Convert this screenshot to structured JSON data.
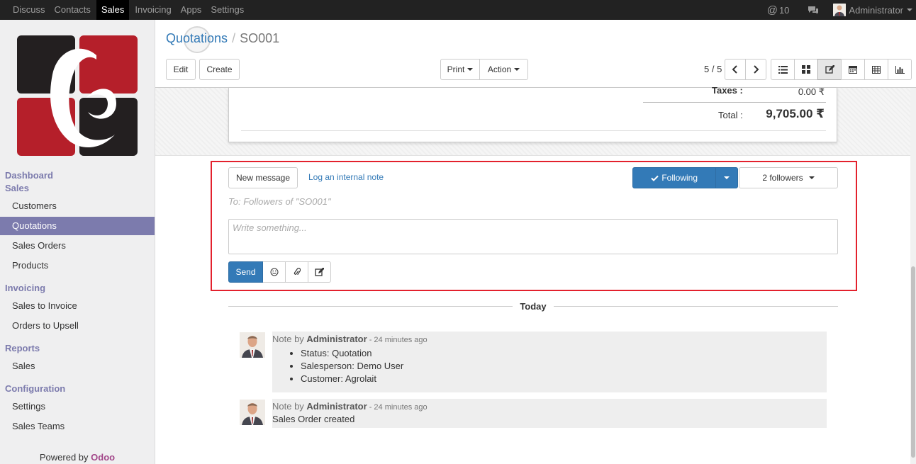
{
  "topbar": {
    "menu": [
      "Discuss",
      "Contacts",
      "Sales",
      "Invoicing",
      "Apps",
      "Settings"
    ],
    "active_menu": "Sales",
    "mentions_count": "10",
    "user_name": "Administrator"
  },
  "sidebar": {
    "dashboard_label": "Dashboard",
    "sales_label": "Sales",
    "sales_items": [
      "Customers",
      "Quotations",
      "Sales Orders",
      "Products"
    ],
    "invoicing_label": "Invoicing",
    "invoicing_items": [
      "Sales to Invoice",
      "Orders to Upsell"
    ],
    "reports_label": "Reports",
    "reports_items": [
      "Sales"
    ],
    "configuration_label": "Configuration",
    "configuration_items": [
      "Settings",
      "Sales Teams"
    ],
    "powered_prefix": "Powered by ",
    "powered_brand": "Odoo"
  },
  "control": {
    "breadcrumb_parent": "Quotations",
    "breadcrumb_sep": "/",
    "breadcrumb_current": "SO001",
    "edit_label": "Edit",
    "create_label": "Create",
    "print_label": "Print",
    "action_label": "Action",
    "pager": "5 / 5"
  },
  "form": {
    "taxes_label": "Taxes :",
    "taxes_value": "0.00 ₹",
    "total_label": "Total :",
    "total_value": "9,705.00 ₹"
  },
  "chatter": {
    "new_message_label": "New message",
    "log_note_label": "Log an internal note",
    "following_label": "Following",
    "followers_label": "2 followers",
    "to_text": "To: Followers of \"SO001\"",
    "composer_placeholder": "Write something...",
    "send_label": "Send",
    "today_label": "Today",
    "messages": [
      {
        "prefix": "Note by ",
        "author": "Administrator",
        "time": " - 24 minutes ago",
        "lines": [
          "Status: Quotation",
          "Salesperson: Demo User",
          "Customer: Agrolait"
        ]
      },
      {
        "prefix": "Note by ",
        "author": "Administrator",
        "time": " - 24 minutes ago",
        "body": "Sales Order created"
      }
    ]
  },
  "colors": {
    "topbar_bg": "#222222",
    "sidebar_accent": "#7c7bad",
    "primary": "#337ab7",
    "highlight": "#e3212d",
    "odoo_brand": "#a24689"
  }
}
